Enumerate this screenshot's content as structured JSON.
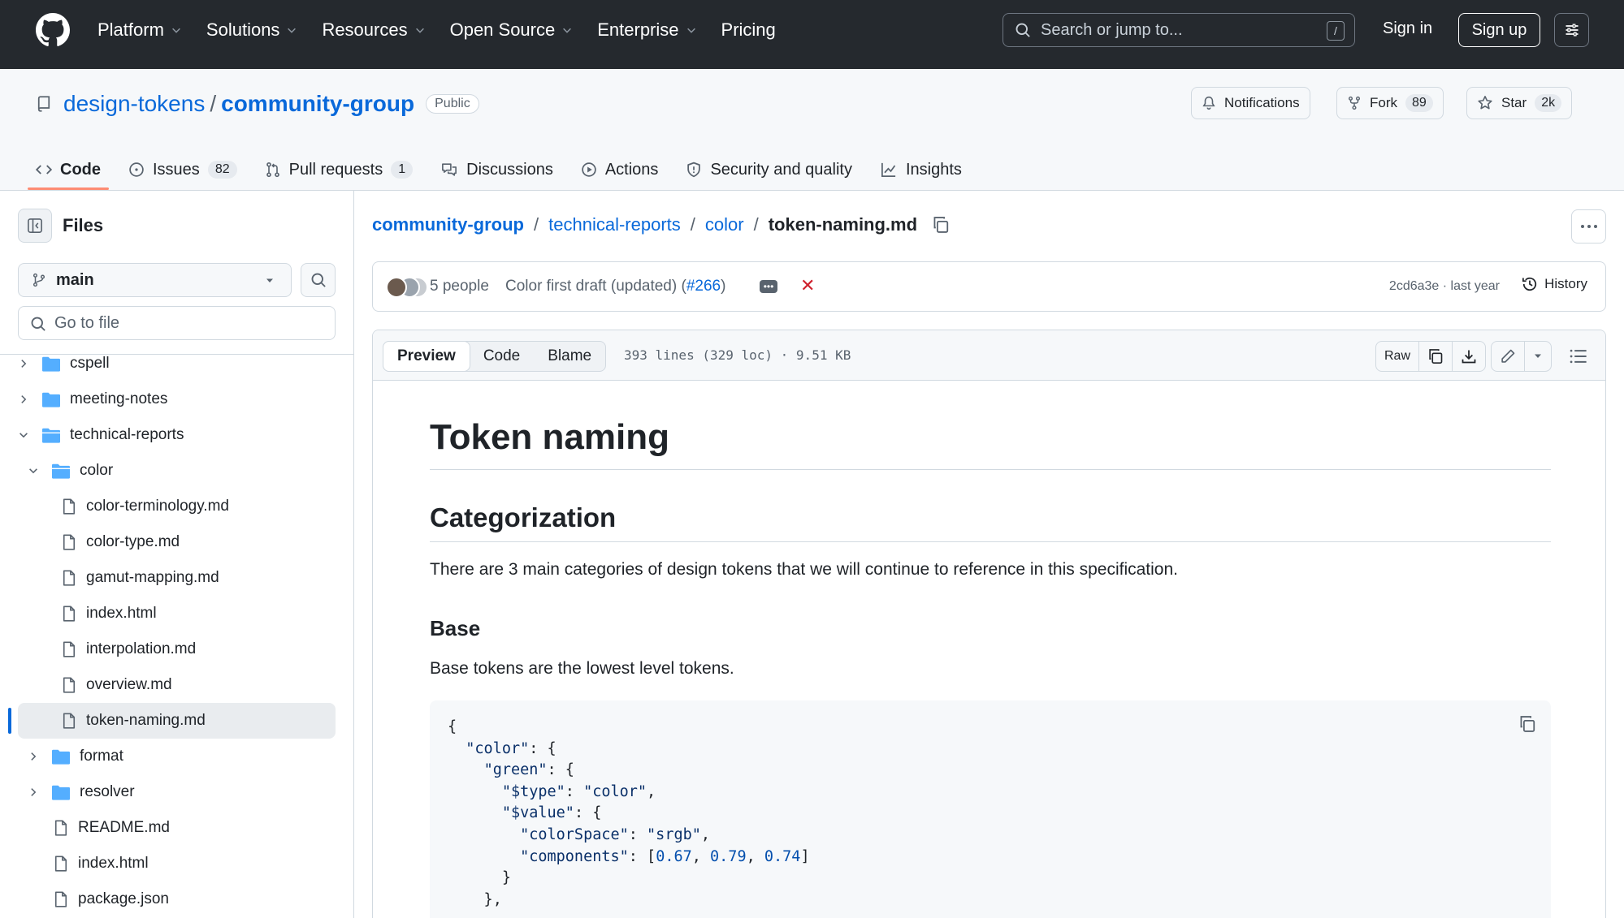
{
  "header": {
    "nav": [
      "Platform",
      "Solutions",
      "Resources",
      "Open Source",
      "Enterprise",
      "Pricing"
    ],
    "search_placeholder": "Search or jump to...",
    "search_shortcut": "/",
    "sign_in": "Sign in",
    "sign_up": "Sign up"
  },
  "repo": {
    "owner": "design-tokens",
    "separator": "/",
    "name": "community-group",
    "visibility": "Public",
    "notifications_label": "Notifications",
    "fork_label": "Fork",
    "fork_count": "89",
    "star_label": "Star",
    "star_count": "2k",
    "tabs": [
      {
        "label": "Code"
      },
      {
        "label": "Issues",
        "count": "82"
      },
      {
        "label": "Pull requests",
        "count": "1"
      },
      {
        "label": "Discussions"
      },
      {
        "label": "Actions"
      },
      {
        "label": "Security and quality"
      },
      {
        "label": "Insights"
      }
    ]
  },
  "sidebar": {
    "title": "Files",
    "branch": "main",
    "goto_placeholder": "Go to file",
    "tree": [
      {
        "label": "cspell",
        "type": "folder",
        "state": "collapsed"
      },
      {
        "label": "meeting-notes",
        "type": "folder",
        "state": "collapsed"
      },
      {
        "label": "technical-reports",
        "type": "folder",
        "state": "expanded"
      },
      {
        "label": "color",
        "type": "folder",
        "state": "expanded"
      },
      {
        "label": "color-terminology.md",
        "type": "file"
      },
      {
        "label": "color-type.md",
        "type": "file"
      },
      {
        "label": "gamut-mapping.md",
        "type": "file"
      },
      {
        "label": "index.html",
        "type": "file"
      },
      {
        "label": "interpolation.md",
        "type": "file"
      },
      {
        "label": "overview.md",
        "type": "file"
      },
      {
        "label": "token-naming.md",
        "type": "file",
        "selected": true
      },
      {
        "label": "format",
        "type": "folder",
        "state": "collapsed"
      },
      {
        "label": "resolver",
        "type": "folder",
        "state": "collapsed"
      },
      {
        "label": "README.md",
        "type": "file"
      },
      {
        "label": "index.html",
        "type": "file"
      },
      {
        "label": "package.json",
        "type": "file"
      }
    ]
  },
  "breadcrumb": {
    "items": [
      "community-group",
      "technical-reports",
      "color"
    ],
    "current": "token-naming.md"
  },
  "commit": {
    "people": "5 people",
    "message": "Color first draft (updated) (",
    "pr": "#266",
    "message_end": ")",
    "sha": "2cd6a3e",
    "when": "last year",
    "meta_sep": " · ",
    "history_label": "History"
  },
  "file": {
    "view_tabs": [
      "Preview",
      "Code",
      "Blame"
    ],
    "info": "393 lines (329 loc) · 9.51 KB",
    "raw_label": "Raw"
  },
  "markdown": {
    "h1": "Token naming",
    "h2": "Categorization",
    "p1": "There are 3 main categories of design tokens that we will continue to reference in this specification.",
    "h3": "Base",
    "p2": "Base tokens are the lowest level tokens.",
    "code_lines": [
      "{",
      "  \"color\": {",
      "    \"green\": {",
      "      \"$type\": \"color\",",
      "      \"$value\": {",
      "        \"colorSpace\": \"srgb\",",
      "        \"components\": [0.67, 0.79, 0.74]",
      "      }",
      "    },"
    ]
  },
  "colors": {
    "header_bg": "#25292e",
    "link": "#0969da",
    "tab_underline": "#fd8c73",
    "folder": "#54aeff"
  }
}
